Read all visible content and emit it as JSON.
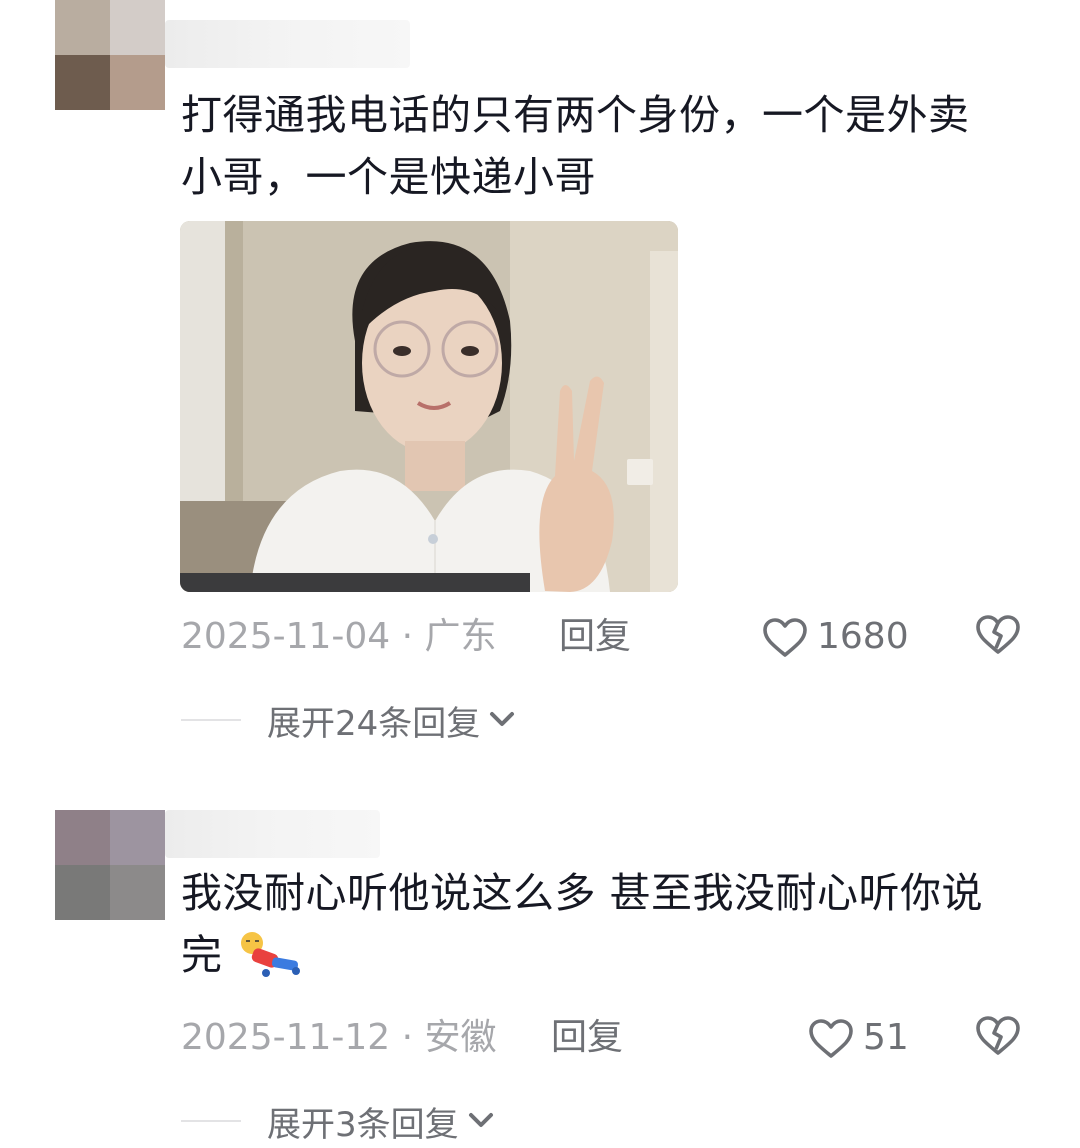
{
  "comments": [
    {
      "text": "打得通我电话的只有两个身份，一个是外卖小哥，一个是快递小哥",
      "has_image": true,
      "date_location": "2025-11-04 · 广东",
      "reply_label": "回复",
      "like_count": "1680",
      "expand_label": "展开24条回复"
    },
    {
      "text": "我没耐心听他说这么多 甚至我没耐心听你说完",
      "emoji_icon": "collapsed-figure-emoji",
      "date_location": "2025-11-12 · 安徽",
      "reply_label": "回复",
      "like_count": "51",
      "expand_label": "展开3条回复"
    }
  ],
  "icons": {
    "like": "heart-outline-icon",
    "dislike": "broken-heart-icon",
    "expand": "chevron-down-icon"
  },
  "colors": {
    "text": "#161823",
    "meta": "#a6a7ab",
    "action": "#6e7075"
  }
}
